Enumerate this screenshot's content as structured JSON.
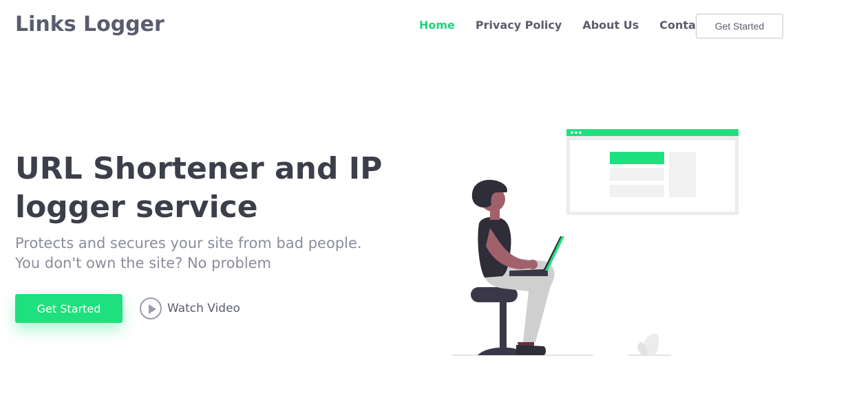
{
  "header": {
    "logo": "Links Logger",
    "nav": [
      {
        "label": "Home",
        "active": true
      },
      {
        "label": "Privacy Policy",
        "active": false
      },
      {
        "label": "About Us",
        "active": false
      },
      {
        "label": "Contact",
        "active": false
      }
    ],
    "cta_label": "Get Started"
  },
  "hero": {
    "title": "URL Shortener and IP logger service",
    "subtitle_line1": "Protects and secures your site from bad people.",
    "subtitle_line2": "You don't own the site? No problem",
    "primary_button": "Get Started",
    "watch_video_label": "Watch Video"
  },
  "colors": {
    "accent": "#1ee07e",
    "nav_active": "#1fd47c",
    "text_dark": "#3c3f4a",
    "text_muted": "#8a8d9a"
  },
  "icons": {
    "play": "play-icon"
  }
}
